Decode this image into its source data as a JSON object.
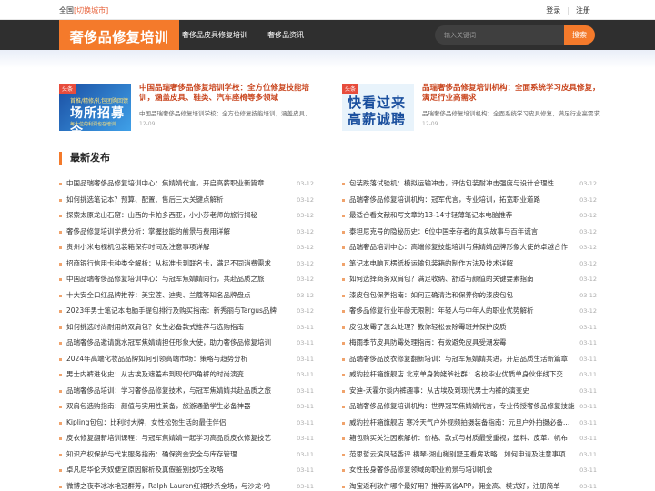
{
  "topbar": {
    "region_label": "全国",
    "switch_city": "[切换城市]",
    "login": "登录",
    "separator": "|",
    "register": "注册"
  },
  "header": {
    "logo": "奢侈品修复培训",
    "nav": [
      "奢侈品皮具修复培训",
      "奢侈品资讯"
    ],
    "search": {
      "placeholder": "输入关键词",
      "button": "搜索"
    }
  },
  "featured": [
    {
      "tag": "头条",
      "thumb_lines": [
        "首推/精修/礼包团购回馈",
        "场所招募令",
        "每十位的利润也在培训"
      ],
      "title": "中国品瑞奢侈品修复培训学校：全方位修复技能培训，涵盖皮具、鞋类、汽车座椅等多领域",
      "desc": "中国品瑞奢侈品修复培训学校：全方位修复技能培训，涵盖皮具、鞋类、汽车座椅等多领域",
      "date": "12-09"
    },
    {
      "tag": "头条",
      "thumb_lines": [
        "快看过来",
        "高薪诚聘"
      ],
      "title": "品瑞奢侈品修复培训机构：全面系统学习皮具修复，满足行业高需求",
      "desc": "品瑞奢侈品修复培训机构：全面系统学习皮具修复，满足行业高需求",
      "date": "12-09"
    }
  ],
  "latest": {
    "title": "最新发布",
    "left": [
      {
        "title": "中国品瑞奢侈品修复培训中心：焦婧婧代言，开启高薪职业新篇章",
        "date": "03-12"
      },
      {
        "title": "如何挑选笔记本？预算、配置、售后三大关键点解析",
        "date": "03-12"
      },
      {
        "title": "探索太原龙山石窟：山西的卡帕多西亚，小小莎老师的旅行揭秘",
        "date": "03-12"
      },
      {
        "title": "奢侈品修复培训学费分析：掌握技能的前景与费用详解",
        "date": "03-12"
      },
      {
        "title": "贵州小米电视机包装箱保存时间及注意事项详解",
        "date": "03-12"
      },
      {
        "title": "招商银行信用卡种类全解析：从标准卡到联名卡，满足不同消费需求",
        "date": "03-12"
      },
      {
        "title": "中国品瑞奢侈品修复培训中心：与冠军焦婧婧同行，共赴品质之旅",
        "date": "03-12"
      },
      {
        "title": "十大安全口红品牌推荐：美宝莲、迪奥、兰蔻等知名品牌盘点",
        "date": "03-12"
      },
      {
        "title": "2023年男士笔记本电脑手提包排行及购买指南：新秀丽与Targus品牌",
        "date": "03-12"
      },
      {
        "title": "如何挑选时尚耐用的双肩包？女生必备款式推荐与选购指南",
        "date": "03-11"
      },
      {
        "title": "品瑞奢侈品邀请跳水冠军焦婧婧担任形象大使，助力奢侈品修复培训",
        "date": "03-11"
      },
      {
        "title": "2024年高端化妆品品牌如何引领高端市场：策略与趋势分析",
        "date": "03-11"
      },
      {
        "title": "男士内裤进化史：从古埃及遮羞布到现代四角裤的时尚演变",
        "date": "03-11"
      },
      {
        "title": "品瑞奢侈品培训：学习奢侈品修复技术，与冠军焦婧婧共赴品质之旅",
        "date": "03-11"
      },
      {
        "title": "双肩包选购指南：颜值与实用性兼备，旅游通勤学生必备神器",
        "date": "03-11"
      },
      {
        "title": "Kipling包包：比利时大牌，女性松弛生活的最佳伴侣",
        "date": "03-11"
      },
      {
        "title": "皮衣修复翻新培训课程：与冠军焦婧婧一起学习高品质皮衣修复技艺",
        "date": "03-11"
      },
      {
        "title": "知识产权保护与代发服务指南：确保资金安全与库存管理",
        "date": "03-11"
      },
      {
        "title": "卓凡尼华伦天奴便宜原因解析及真假鉴别技巧全攻略",
        "date": "03-11"
      },
      {
        "title": "微博之夜李冰冰艳冠群芳，Ralph Lauren红裙秒杀全场，与沙龙·哈",
        "date": "03-11"
      }
    ],
    "right": [
      {
        "title": "包装跌落试验机：模拟运输冲击，评估包装耐冲击强度与设计合理性",
        "date": "03-12"
      },
      {
        "title": "品瑞奢侈品修复培训机构：冠军代言，专业培训，拓宽职业道路",
        "date": "03-12"
      },
      {
        "title": "最适合看文献和写文章的13-14寸轻薄笔记本电脑推荐",
        "date": "03-12"
      },
      {
        "title": "泰坦尼克号的隐秘历史：6位中国幸存者的真实故事与百年谎言",
        "date": "03-12"
      },
      {
        "title": "品瑞奢品培训中心：高端修复技能培训与焦婧婧品牌形象大使的卓越合作",
        "date": "03-12"
      },
      {
        "title": "笔记本电脑瓦楞纸板运输包装箱的制作方法及技术详解",
        "date": "03-12"
      },
      {
        "title": "如何选择商务双肩包？满足收纳、舒适与颜值的关键要素指南",
        "date": "03-12"
      },
      {
        "title": "漆皮包包保养指南：如何正确清洁和保养你的漆皮包包",
        "date": "03-12"
      },
      {
        "title": "奢侈品修复行业年龄无限制：年轻人与中年人的职业优势解析",
        "date": "03-12"
      },
      {
        "title": "皮包发霉了怎么处理？教你轻松去除霉斑并保护皮质",
        "date": "03-11"
      },
      {
        "title": "梅雨季节皮具防霉处理指南：有效避免皮具受潮发霉",
        "date": "03-11"
      },
      {
        "title": "品瑞奢侈品皮衣修复翻新培训：与冠军焦婧婧共进，开启品质生活新篇章",
        "date": "03-11"
      },
      {
        "title": "威豹拉杆箱旗舰店 北京单身狗姥爷社群：名校毕业优质单身伙伴线下交友活动",
        "date": "03-11"
      },
      {
        "title": "安迪-沃霍尔谈内裤趣事：从古埃及到现代男士内裤的演变史",
        "date": "03-11"
      },
      {
        "title": "品瑞奢侈品修复培训机构：世界冠军焦婧婧代言，专业传授奢侈品修复技能",
        "date": "03-11"
      },
      {
        "title": "威豹拉杆箱旗舰店 寒冷天气户外视频拍摄装备指南：元旦户外拍摄必备技巧",
        "date": "03-11"
      },
      {
        "title": "箱包购买关注因素解析：价格、款式与材质最受重视，塑料、皮革、帆布",
        "date": "03-11"
      },
      {
        "title": "范思哲云滨风轻香评 横琴-湖山樾别墅王看房攻略：如何申请及注意事项",
        "date": "03-11"
      },
      {
        "title": "女性投身奢侈品修复领域的职业前景与培训机会",
        "date": "03-11"
      },
      {
        "title": "淘宝返利软件哪个最好用？推荐高省APP，佣金高、模式好，注册简单",
        "date": "03-11"
      }
    ]
  }
}
